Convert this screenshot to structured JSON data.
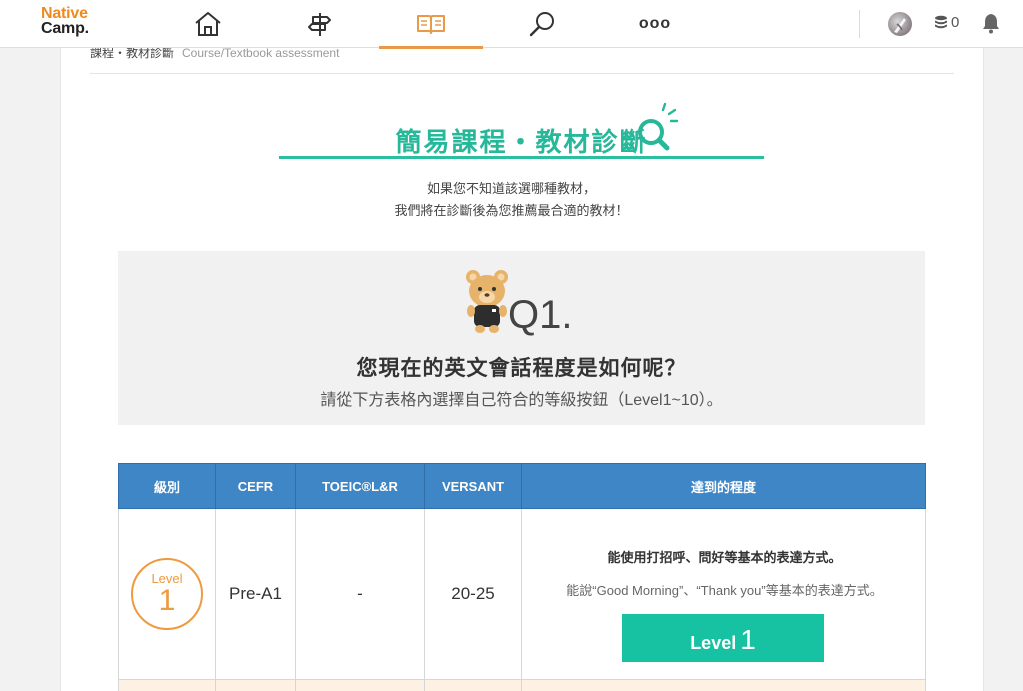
{
  "header": {
    "logo_line1": "Native",
    "logo_line2": "Camp.",
    "coin_count": "0",
    "nav": [
      {
        "icon": "home-icon"
      },
      {
        "icon": "signpost-icon"
      },
      {
        "icon": "book-icon",
        "active": true
      },
      {
        "icon": "search-icon"
      },
      {
        "icon": "more-icon",
        "label": "ooo"
      }
    ],
    "accent": "#e89a4a"
  },
  "breadcrumb": {
    "label": "課程・教材診斷",
    "sub": "Course/Textbook assessment"
  },
  "page": {
    "title": "簡易課程・教材診斷",
    "intro_line1": "如果您不知道該選哪種教材，",
    "intro_line2": "我們將在診斷後為您推薦最合適的教材！",
    "title_color": "#27b89a"
  },
  "question": {
    "number": "Q1.",
    "title": "您現在的英文會話程度是如何呢？",
    "subtitle": "請從下方表格內選擇自己符合的等級按鈕（Level1~10）。"
  },
  "table": {
    "headers": [
      "級別",
      "CEFR",
      "TOEIC®L&R",
      "VERSANT",
      "達到的程度"
    ],
    "rows": [
      {
        "level_word": "Level",
        "level_num": "1",
        "cefr": "Pre-A1",
        "toeic": "-",
        "versant": "20-25",
        "desc_main": "能使用打招呼、問好等基本的表達方式。",
        "desc_sub": "能說“Good Morning”、“Thank you”等基本的表達方式。",
        "button_word": "Level",
        "button_num": "1"
      }
    ],
    "header_color": "#3f86c6",
    "button_color": "#17c2a2"
  }
}
